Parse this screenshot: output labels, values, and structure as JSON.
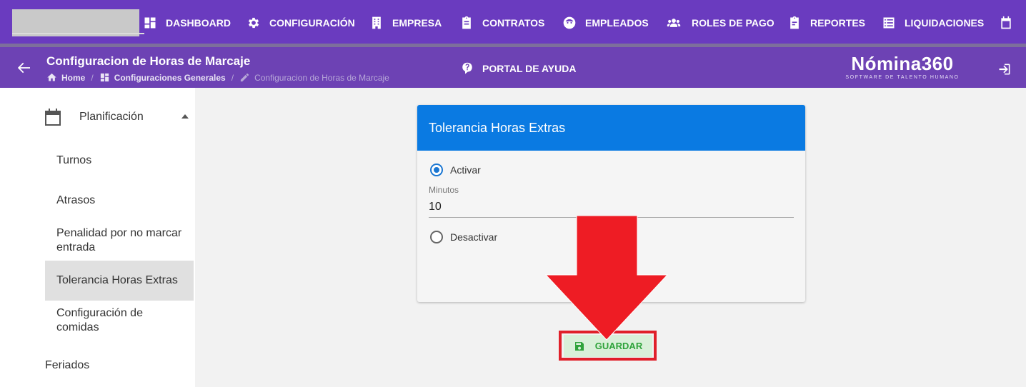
{
  "nav": {
    "items": [
      {
        "label": "DASHBOARD",
        "icon": "dashboard-icon"
      },
      {
        "label": "CONFIGURACIÓN",
        "icon": "gear-icon"
      },
      {
        "label": "EMPRESA",
        "icon": "building-icon"
      },
      {
        "label": "CONTRATOS",
        "icon": "clipboard-icon"
      },
      {
        "label": "EMPLEADOS",
        "icon": "face-icon"
      },
      {
        "label": "ROLES DE PAGO",
        "icon": "group-icon"
      },
      {
        "label": "REPORTES",
        "icon": "report-icon"
      },
      {
        "label": "LIQUIDACIONES",
        "icon": "list-icon"
      }
    ],
    "trailing_icon": "calendar-icon"
  },
  "header": {
    "title": "Configuracion de Horas de Marcaje",
    "breadcrumb": [
      {
        "label": "Home",
        "icon": "home-icon"
      },
      {
        "label": "Configuraciones Generales",
        "icon": "dashboard-icon"
      },
      {
        "label": "Configuracion de Horas de Marcaje",
        "icon": "pencil-icon"
      }
    ],
    "help_label": "PORTAL DE AYUDA",
    "logo_main": "Nómina360",
    "logo_sub": "SOFTWARE DE TALENTO HUMANO"
  },
  "sidebar": {
    "group_label": "Planificación",
    "items": [
      {
        "label": "Turnos"
      },
      {
        "label": "Atrasos"
      },
      {
        "label": "Penalidad por no marcar entrada"
      },
      {
        "label": "Tolerancia Horas Extras",
        "active": true
      },
      {
        "label": "Configuración de comidas"
      }
    ],
    "bottom_item": "Feriados"
  },
  "card": {
    "title": "Tolerancia Horas Extras",
    "option_on": "Activar",
    "option_off": "Desactivar",
    "selected": "Activar",
    "minutes_label": "Minutos",
    "minutes_value": "10"
  },
  "save_label": "GUARDAR",
  "colors": {
    "nav_bg": "#6a3bbf",
    "header_bg": "#6d42b4",
    "card_header": "#0a7ae2",
    "save_text": "#2fa33b",
    "highlight_red": "#e0202a"
  }
}
